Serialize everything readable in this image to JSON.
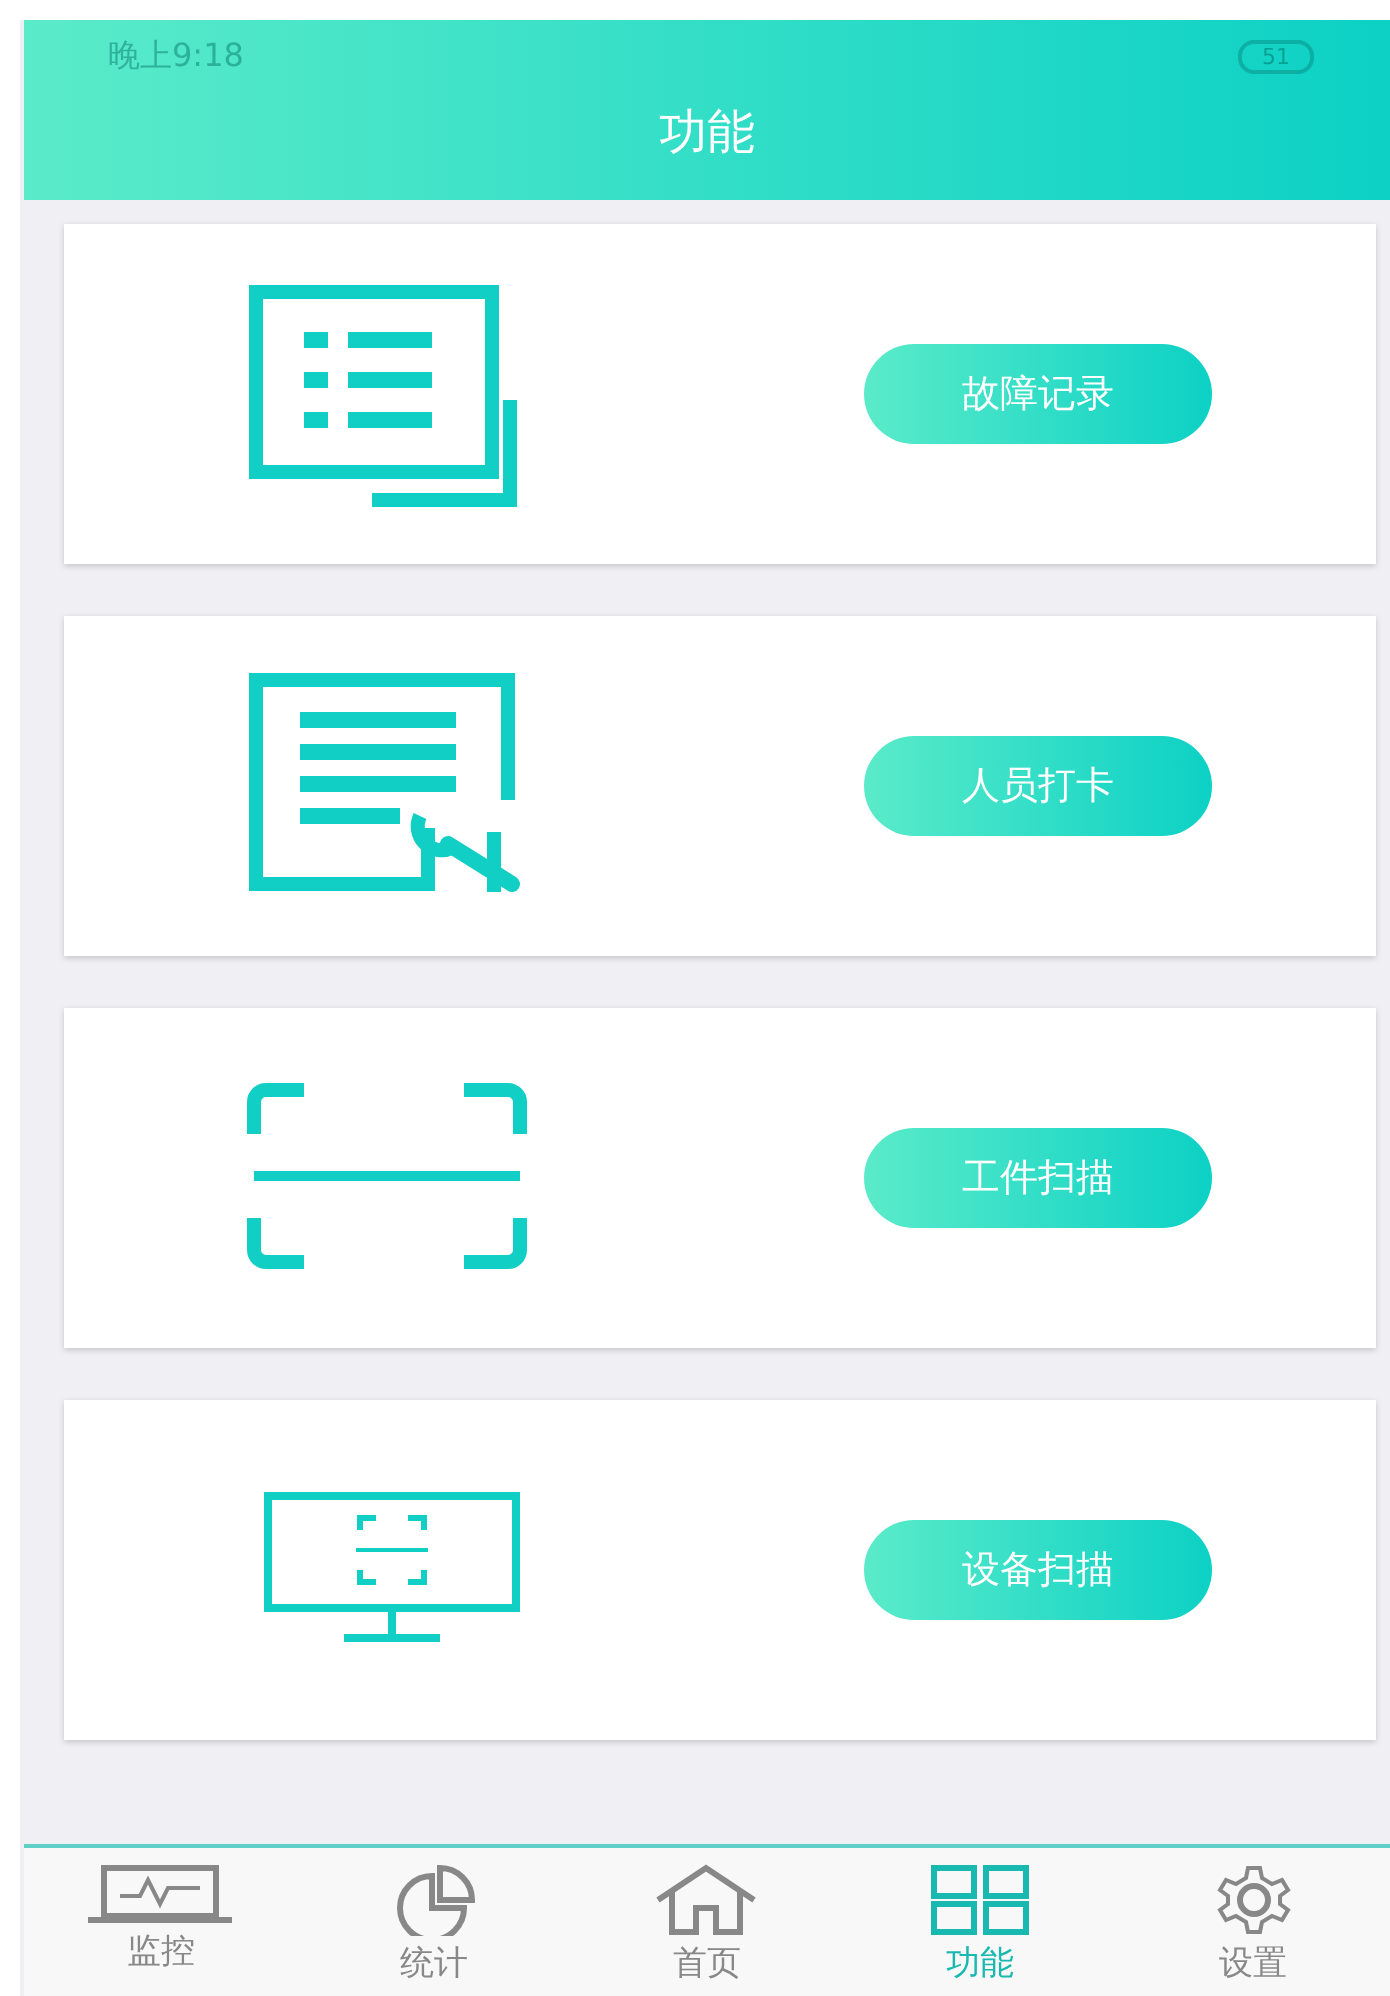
{
  "status_bar": {
    "time": "晚上9:18",
    "battery": "51"
  },
  "header": {
    "title": "功能"
  },
  "cards": [
    {
      "kind": "records",
      "button": "故障记录"
    },
    {
      "kind": "checkin",
      "button": "人员打卡"
    },
    {
      "kind": "scan",
      "button": "工件扫描"
    },
    {
      "kind": "device",
      "button": "设备扫描"
    }
  ],
  "nav": [
    {
      "kind": "monitor",
      "label": "监控",
      "selected": false
    },
    {
      "kind": "stats",
      "label": "统计",
      "selected": false
    },
    {
      "kind": "home",
      "label": "首页",
      "selected": false
    },
    {
      "kind": "grid",
      "label": "功能",
      "selected": true
    },
    {
      "kind": "settings",
      "label": "设置",
      "selected": false
    }
  ]
}
